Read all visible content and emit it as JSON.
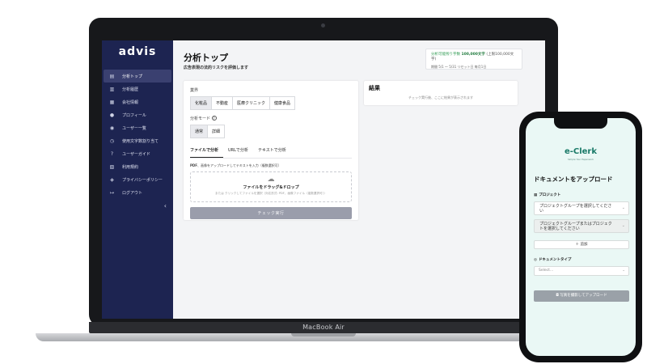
{
  "laptop": {
    "brand_label": "MacBook Air",
    "logo": "advis",
    "sidebar": {
      "items": [
        {
          "label": "分析トップ",
          "icon": "document-icon",
          "active": true
        },
        {
          "label": "分析履歴",
          "icon": "history-icon"
        },
        {
          "label": "会社情報",
          "icon": "building-icon"
        },
        {
          "label": "プロフィール",
          "icon": "user-icon"
        },
        {
          "label": "ユーザー一覧",
          "icon": "users-icon"
        },
        {
          "label": "使用文字数割り当て",
          "icon": "clock-icon"
        },
        {
          "label": "ユーザーガイド",
          "icon": "help-icon"
        },
        {
          "label": "利用規約",
          "icon": "terms-icon"
        },
        {
          "label": "プライバシーポリシー",
          "icon": "shield-icon"
        },
        {
          "label": "ログアウト",
          "icon": "logout-icon"
        }
      ],
      "collapse_glyph": "‹"
    },
    "main": {
      "title": "分析トップ",
      "subtitle": "広告表現の法的リスクを評価します",
      "usage": {
        "line1_prefix": "分析可能残り字数",
        "line1_value": "100,000文字",
        "line1_suffix": "(上限100,000文字)",
        "line2": "期間 5/1 〜 5/31 リセット日 毎月1日"
      },
      "industry": {
        "label": "業界",
        "options": [
          "化粧品",
          "不動産",
          "医療クリニック",
          "健康食品"
        ],
        "selected": "化粧品"
      },
      "mode": {
        "label": "分析モード",
        "options": [
          "通常",
          "詳細"
        ],
        "selected": "通常"
      },
      "tabs": [
        "ファイルで分析",
        "URLで分析",
        "テキストで分析"
      ],
      "active_tab": "ファイルで分析",
      "hint_bold": "PDF",
      "hint_rest": "、画像をアップロードしてテキストを入力（複数選択可）",
      "dropzone": {
        "title": "ファイルをドラッグ&ドロップ",
        "sub": "または クリックしてファイルを選択（対応形式: PDF、画像ファイル（複数選択可））"
      },
      "run_button": "チェック実行",
      "result": {
        "title": "結果",
        "placeholder": "チェック実行後、ここに結果が表示されます"
      }
    }
  },
  "phone": {
    "brand": "e-Clerk",
    "tagline": "Simple Your Paperwork",
    "title": "ドキュメントをアップロード",
    "project_label": "プロジェクト",
    "select1": "プロジェクトグループを選択してください",
    "select2": "プロジェクトグループまたはプロジェクトを選択してください",
    "add_button": "＋ 追加",
    "doc_type_label": "ドキュメントタイプ",
    "doc_type_placeholder": "Select...",
    "upload_button": "写真を撮影してアップロード"
  }
}
